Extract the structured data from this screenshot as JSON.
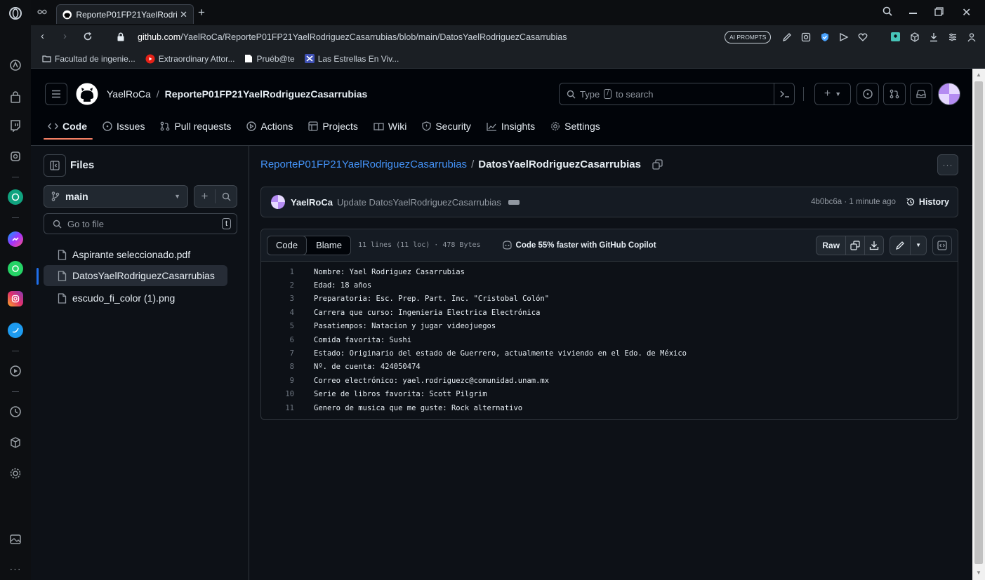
{
  "browser": {
    "tab_title": "ReporteP01FP21YaelRodrig",
    "url_host": "github.com",
    "url_path": "/YaelRoCa/ReporteP01FP21YaelRodriguezCasarrubias/blob/main/DatosYaelRodriguezCasarrubias",
    "ai_prompts_label": "AI PROMPTS",
    "bookmarks": [
      {
        "label": "Facultad de ingenie...",
        "icon": "folder-icon"
      },
      {
        "label": "Extraordinary Attor...",
        "icon": "youtube-icon"
      },
      {
        "label": "Pruéb@te",
        "icon": "doc-icon"
      },
      {
        "label": "Las Estrellas En Viv...",
        "icon": "star-tv-icon"
      }
    ]
  },
  "header": {
    "owner": "YaelRoCa",
    "separator": "/",
    "repo": "ReporteP01FP21YaelRodriguezCasarrubias",
    "search_prefix": "Type",
    "search_key": "/",
    "search_suffix": "to search"
  },
  "repo_tabs": [
    {
      "label": "Code",
      "icon": "code-icon"
    },
    {
      "label": "Issues",
      "icon": "issue-icon"
    },
    {
      "label": "Pull requests",
      "icon": "pull-request-icon"
    },
    {
      "label": "Actions",
      "icon": "play-icon"
    },
    {
      "label": "Projects",
      "icon": "table-icon"
    },
    {
      "label": "Wiki",
      "icon": "book-icon"
    },
    {
      "label": "Security",
      "icon": "shield-icon"
    },
    {
      "label": "Insights",
      "icon": "graph-icon"
    },
    {
      "label": "Settings",
      "icon": "gear-icon"
    }
  ],
  "files_panel": {
    "title": "Files",
    "branch": "main",
    "go_to_file_placeholder": "Go to file",
    "shortcut_key": "t",
    "files": [
      {
        "name": "Aspirante seleccionado.pdf",
        "selected": false
      },
      {
        "name": "DatosYaelRodriguezCasarrubias",
        "selected": true
      },
      {
        "name": "escudo_fi_color (1).png",
        "selected": false
      }
    ]
  },
  "breadcrumb": {
    "repo": "ReporteP01FP21YaelRodriguezCasarrubias",
    "separator": "/",
    "file": "DatosYaelRodriguezCasarrubias"
  },
  "commit": {
    "author": "YaelRoCa",
    "message": "Update DatosYaelRodriguezCasarrubias",
    "sha_time": "4b0bc6a · 1 minute ago",
    "history_label": "History"
  },
  "file_toolbar": {
    "code_tab": "Code",
    "blame_tab": "Blame",
    "stats": "11 lines (11 loc) · 478 Bytes",
    "copilot": "Code 55% faster with GitHub Copilot",
    "raw": "Raw"
  },
  "code_lines": [
    "Nombre: Yael Rodriguez Casarrubias",
    "Edad: 18 años",
    "Preparatoria: Esc. Prep. Part. Inc. \"Cristobal Colón\"",
    "Carrera que curso: Ingenieria Electrica Electrónica",
    "Pasatiempos: Natacion y jugar videojuegos",
    "Comida favorita: Sushi",
    "Estado: Originario del estado de Guerrero, actualmente viviendo en el Edo. de México",
    "Nº. de cuenta: 424050474",
    "Correo electrónico: yael.rodriguezc@comunidad.unam.mx",
    "Serie de libros favorita: Scott Pilgrim",
    "Genero de musica que me guste: Rock alternativo"
  ],
  "colors": {
    "accent_link": "#4493f8",
    "selected_bar": "#1f6feb",
    "tab_underline": "#f78166",
    "bg": "#0d1117"
  }
}
